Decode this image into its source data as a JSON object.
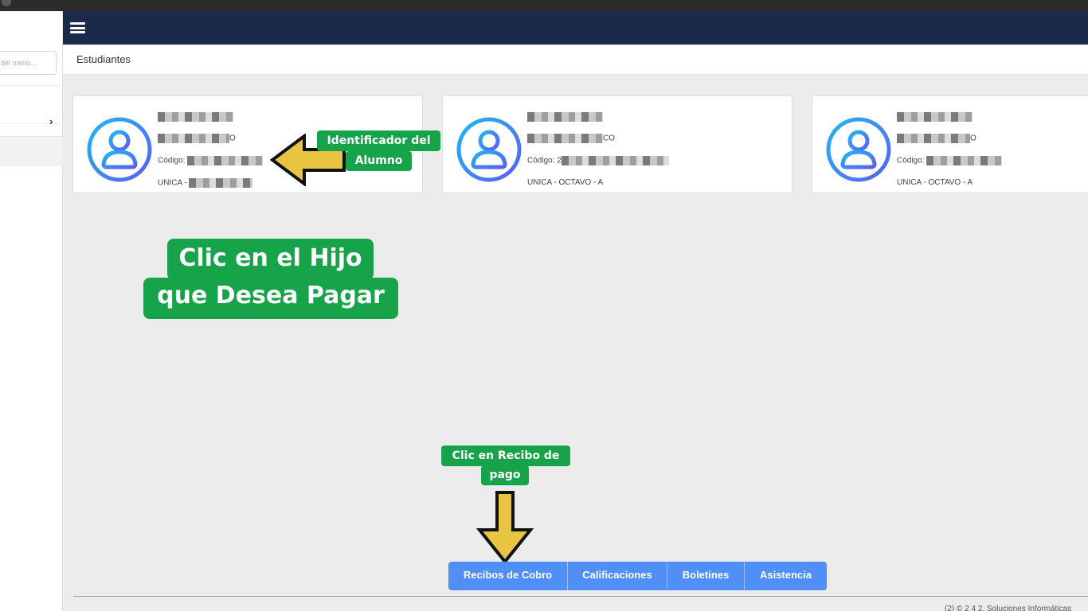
{
  "sidebar": {
    "search_placeholder": "del menú..."
  },
  "breadcrumb": {
    "title": "Estudiantes"
  },
  "students": [
    {
      "code_label": "Código:",
      "code_prefix": "",
      "line2_tail": "O",
      "line4_text": "UNICA -"
    },
    {
      "code_label": "Código:",
      "code_prefix": "2",
      "line2_tail": "CO",
      "line4_text": "UNICA - OCTAVO - A"
    },
    {
      "code_label": "Código:",
      "code_prefix": "",
      "line2_tail": "O",
      "line4_text": "UNICA - OCTAVO - A"
    }
  ],
  "annotations": {
    "id_line1": "Identificador del",
    "id_line2": "Alumno",
    "big_line1": "Clic en el Hijo",
    "big_line2": "que Desea Pagar",
    "receipt_line1": "Clic en Recibo de",
    "receipt_line2": "pago"
  },
  "tabs": [
    "Recibos de Cobro",
    "Calificaciones",
    "Boletines",
    "Asistencia"
  ],
  "footer": {
    "text": "(2) © 2 4 2, Soluciones Informáticas"
  },
  "colors": {
    "topbar": "#1b2a4a",
    "annotation_green": "#16a34a",
    "arrow_yellow": "#e8c443",
    "tab_blue": "#4f8ff7"
  }
}
